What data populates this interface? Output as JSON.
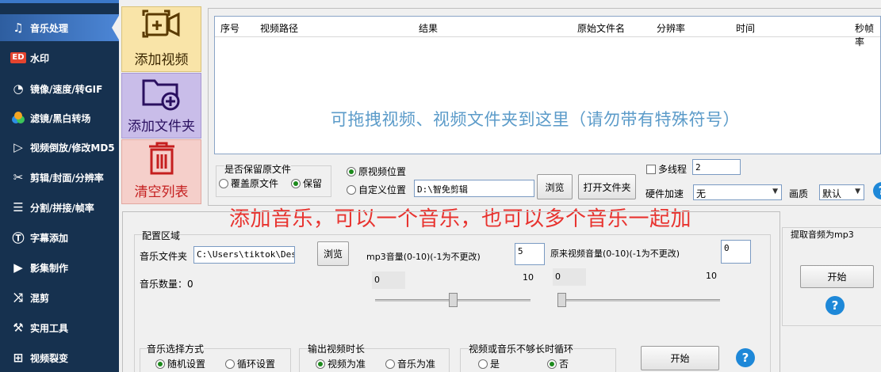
{
  "sidebar": {
    "items": [
      {
        "label": "音乐处理",
        "icon": "music-icon"
      },
      {
        "label": "水印",
        "icon": "watermark-badge-icon",
        "badge": "ED"
      },
      {
        "label": "镜像/速度/转GIF",
        "icon": "speed-icon"
      },
      {
        "label": "滤镜/黑白转场",
        "icon": "filter-icon"
      },
      {
        "label": "视频倒放/修改MD5",
        "icon": "reverse-icon"
      },
      {
        "label": "剪辑/封面/分辨率",
        "icon": "scissors-icon"
      },
      {
        "label": "分割/拼接/帧率",
        "icon": "split-icon"
      },
      {
        "label": "字幕添加",
        "icon": "subtitle-icon"
      },
      {
        "label": "影集制作",
        "icon": "album-icon"
      },
      {
        "label": "混剪",
        "icon": "shuffle-icon"
      },
      {
        "label": "实用工具",
        "icon": "toolbox-icon"
      },
      {
        "label": "视频裂变",
        "icon": "fission-icon"
      }
    ]
  },
  "tiles": {
    "add_video": "添加视频",
    "add_folder": "添加文件夹",
    "clear_list": "清空列表"
  },
  "table": {
    "columns": [
      "序号",
      "视频路径",
      "结果",
      "原始文件名",
      "分辨率",
      "时间",
      "秒帧率"
    ],
    "drop_hint": "可拖拽视频、视频文件夹到这里（请勿带有特殊符号）"
  },
  "keep_original": {
    "label": "是否保留原文件",
    "overwrite": "覆盖原文件",
    "keep": "保留",
    "selected": "keep"
  },
  "output_location": {
    "original": "原视频位置",
    "custom": "自定义位置",
    "path": "D:\\智免剪辑",
    "browse": "浏览",
    "open_folder": "打开文件夹",
    "selected": "original"
  },
  "options": {
    "multithread_label": "多线程",
    "thread_count": "2",
    "hw_accel_label": "硬件加速",
    "hw_accel_value": "无",
    "quality_label": "画质",
    "quality_value": "默认"
  },
  "red_title": "添加音乐，可以一个音乐，也可以多个音乐一起加",
  "config": {
    "section_label": "配置区域",
    "music_file_label": "音乐文件夹",
    "music_file_path": "C:\\Users\\tiktok\\Deskt",
    "browse": "浏览",
    "music_count": "音乐数量：0",
    "mp3_volume_label": "mp3音量(0-10)(-1为不更改)",
    "mp3_volume_value": "5",
    "mp3_min": "0",
    "mp3_max": "10",
    "mp3_slider_level": 5,
    "orig_volume_label": "原来视频音量(0-10)(-1为不更改)",
    "orig_volume_value": "0",
    "orig_min": "0",
    "orig_max": "10",
    "orig_slider_level": 0,
    "music_select_label": "音乐选择方式",
    "random": "随机设置",
    "loop": "循环设置",
    "music_select_selected": "random",
    "output_duration_label": "输出视频时长",
    "video_based": "视频为准",
    "music_based": "音乐为准",
    "output_duration_selected": "video",
    "loop_label": "视频或音乐不够长时循环",
    "yes": "是",
    "no": "否",
    "loop_selected": "no",
    "start": "开始",
    "help": "?"
  },
  "extract_audio": {
    "label": "提取音频为mp3",
    "start": "开始",
    "help": "?"
  },
  "colors": {
    "sidebar_bg": "#16314f",
    "sidebar_active": "#4c86d6",
    "red_title": "#e8332f",
    "drop_hint": "#5b9bc9",
    "help_blue": "#1e88d8"
  }
}
